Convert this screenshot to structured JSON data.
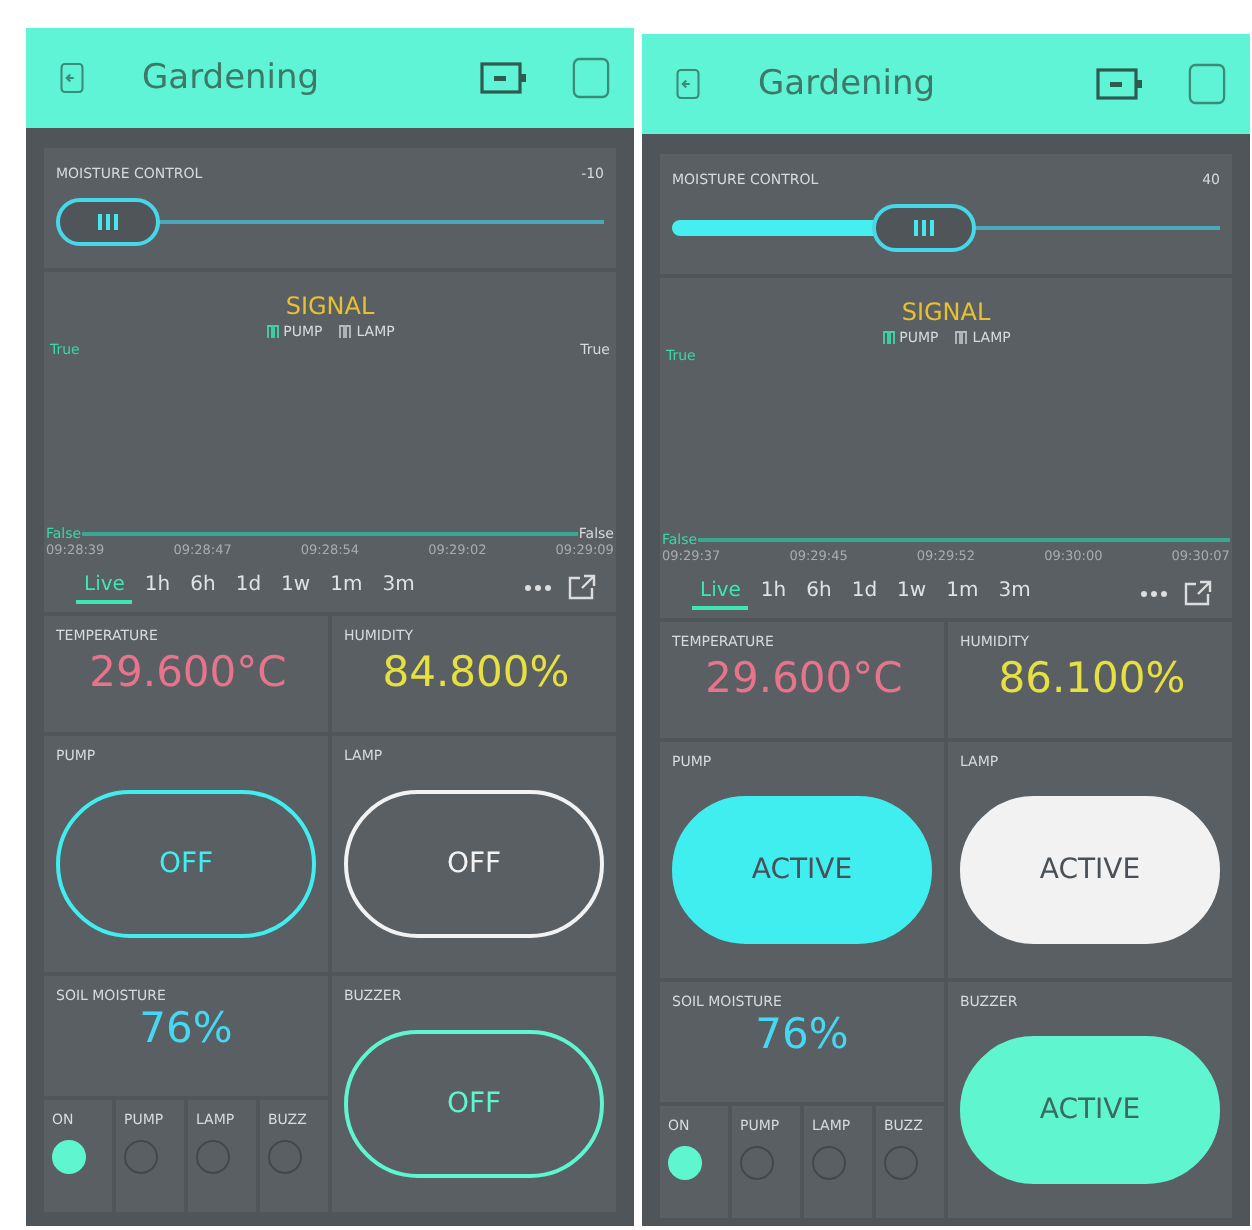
{
  "screens": [
    {
      "header": {
        "title": "Gardening"
      },
      "slider": {
        "label": "MOISTURE CONTROL",
        "reading": "-10",
        "level": 0
      },
      "chart": {
        "title": "SIGNAL",
        "legend": [
          "PUMP",
          "LAMP"
        ],
        "left_top": "True",
        "right_top": "True",
        "left_bottom": "False",
        "right_bottom": "False",
        "times": [
          "09:28:39",
          "09:28:47",
          "09:28:54",
          "09:29:02",
          "09:29:09"
        ]
      },
      "range_tabs": [
        {
          "label": "Live",
          "selected": true
        },
        {
          "label": "1h",
          "selected": false
        },
        {
          "label": "6h",
          "selected": false
        },
        {
          "label": "1d",
          "selected": false
        },
        {
          "label": "1w",
          "selected": false
        },
        {
          "label": "1m",
          "selected": false
        },
        {
          "label": "3m",
          "selected": false
        }
      ],
      "readings": [
        {
          "label": "TEMPERATURE",
          "value": "29.600°C",
          "color": "#e8748c"
        },
        {
          "label": "HUMIDITY",
          "value": "84.800%",
          "color": "#e6e040"
        }
      ],
      "buttons": [
        {
          "label": "PUMP",
          "value": "OFF",
          "active": false,
          "color": "#40eef0"
        },
        {
          "label": "LAMP",
          "value": "OFF",
          "active": false,
          "color": "#f2f2f2"
        }
      ],
      "soil": {
        "label": "SOIL MOISTURE",
        "value": "76%",
        "color": "#46d8f2"
      },
      "leds": [
        {
          "label": "ON",
          "on": true
        },
        {
          "label": "PUMP",
          "on": false
        },
        {
          "label": "LAMP",
          "on": false
        },
        {
          "label": "BUZZ",
          "on": false
        }
      ],
      "buzzer": {
        "label": "BUZZER",
        "value": "OFF",
        "active": false,
        "color": "#5ef5cf"
      }
    },
    {
      "header": {
        "title": "Gardening"
      },
      "slider": {
        "label": "MOISTURE CONTROL",
        "reading": "40",
        "level": 0.45
      },
      "chart": {
        "title": "SIGNAL",
        "legend": [
          "PUMP",
          "LAMP"
        ],
        "left_top": "True",
        "left_bottom": "False",
        "times": [
          "09:29:37",
          "09:29:45",
          "09:29:52",
          "09:30:00",
          "09:30:07"
        ]
      },
      "range_tabs": [
        {
          "label": "Live",
          "selected": true
        },
        {
          "label": "1h",
          "selected": false
        },
        {
          "label": "6h",
          "selected": false
        },
        {
          "label": "1d",
          "selected": false
        },
        {
          "label": "1w",
          "selected": false
        },
        {
          "label": "1m",
          "selected": false
        },
        {
          "label": "3m",
          "selected": false
        }
      ],
      "readings": [
        {
          "label": "TEMPERATURE",
          "value": "29.600°C",
          "color": "#e8748c"
        },
        {
          "label": "HUMIDITY",
          "value": "86.100%",
          "color": "#e6e040"
        }
      ],
      "buttons": [
        {
          "label": "PUMP",
          "value": "ACTIVE",
          "active": true,
          "color": "#40eef0"
        },
        {
          "label": "LAMP",
          "value": "ACTIVE",
          "active": true,
          "color": "#f2f2f2"
        }
      ],
      "soil": {
        "label": "SOIL MOISTURE",
        "value": "76%",
        "color": "#46d8f2"
      },
      "leds": [
        {
          "label": "ON",
          "on": true
        },
        {
          "label": "PUMP",
          "on": false
        },
        {
          "label": "LAMP",
          "on": false
        },
        {
          "label": "BUZZ",
          "on": false
        }
      ],
      "buzzer": {
        "label": "BUZZER",
        "value": "ACTIVE",
        "active": true,
        "color": "#5ef5cf"
      }
    }
  ]
}
